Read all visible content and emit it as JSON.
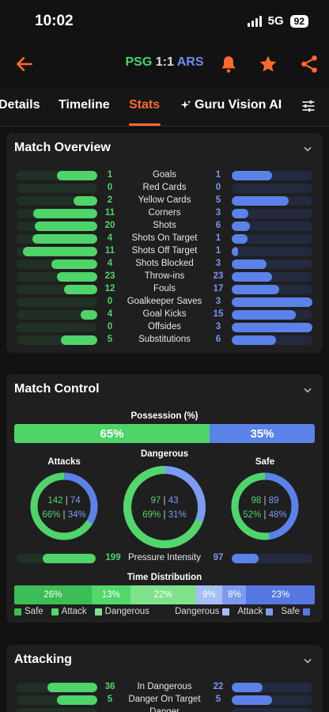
{
  "status_bar": {
    "time": "10:02",
    "network": "5G",
    "battery": "92"
  },
  "header": {
    "home_team": "PSG",
    "score": "1:1",
    "away_team": "ARS"
  },
  "tabs": [
    {
      "label": "Details"
    },
    {
      "label": "Timeline"
    },
    {
      "label": "Stats"
    },
    {
      "label": "Guru Vision AI"
    }
  ],
  "active_tab": "Stats",
  "colors": {
    "accent": "#ff6a2a",
    "home": "#4fd46a",
    "away": "#5b82e8"
  },
  "match_overview": {
    "title": "Match Overview",
    "rows": [
      {
        "label": "Goals",
        "home": "1",
        "away": "1",
        "home_pct": 0.5,
        "away_pct": 0.5
      },
      {
        "label": "Red Cards",
        "home": "0",
        "away": "0",
        "home_pct": 0,
        "away_pct": 0
      },
      {
        "label": "Yellow Cards",
        "home": "2",
        "away": "5",
        "home_pct": 0.29,
        "away_pct": 0.71
      },
      {
        "label": "Corners",
        "home": "11",
        "away": "3",
        "home_pct": 0.79,
        "away_pct": 0.21
      },
      {
        "label": "Shots",
        "home": "20",
        "away": "6",
        "home_pct": 0.77,
        "away_pct": 0.23
      },
      {
        "label": "Shots On Target",
        "home": "4",
        "away": "1",
        "home_pct": 0.8,
        "away_pct": 0.2
      },
      {
        "label": "Shots Off Target",
        "home": "11",
        "away": "1",
        "home_pct": 0.92,
        "away_pct": 0.08
      },
      {
        "label": "Shots Blocked",
        "home": "4",
        "away": "3",
        "home_pct": 0.57,
        "away_pct": 0.43
      },
      {
        "label": "Throw-ins",
        "home": "23",
        "away": "23",
        "home_pct": 0.5,
        "away_pct": 0.5
      },
      {
        "label": "Fouls",
        "home": "12",
        "away": "17",
        "home_pct": 0.41,
        "away_pct": 0.59
      },
      {
        "label": "Goalkeeper Saves",
        "home": "0",
        "away": "3",
        "home_pct": 0,
        "away_pct": 1
      },
      {
        "label": "Goal Kicks",
        "home": "4",
        "away": "15",
        "home_pct": 0.21,
        "away_pct": 0.79
      },
      {
        "label": "Offsides",
        "home": "0",
        "away": "3",
        "home_pct": 0,
        "away_pct": 1
      },
      {
        "label": "Substitutions",
        "home": "5",
        "away": "6",
        "home_pct": 0.45,
        "away_pct": 0.55
      }
    ]
  },
  "match_control": {
    "title": "Match Control",
    "possession_label": "Possession (%)",
    "possession_home": "65%",
    "possession_away": "35%",
    "possession_home_pct": 0.65,
    "attacks": {
      "label": "Attacks",
      "home": "142",
      "away": "74",
      "home_pct": "66%",
      "away_pct": "34%",
      "home_frac": 0.66
    },
    "dangerous": {
      "label": "Dangerous",
      "home": "97",
      "away": "43",
      "home_pct": "69%",
      "away_pct": "31%",
      "home_frac": 0.69
    },
    "safe": {
      "label": "Safe",
      "home": "98",
      "away": "89",
      "home_pct": "52%",
      "away_pct": "48%",
      "home_frac": 0.52
    },
    "pressure": {
      "label": "Pressure Intensity",
      "home": "199",
      "away": "97",
      "home_pct": 0.67,
      "away_pct": 0.33
    },
    "time_distribution": {
      "label": "Time Distribution",
      "segments": [
        {
          "value": "26%",
          "frac": 0.26,
          "color": "#3dbd55"
        },
        {
          "value": "13%",
          "frac": 0.13,
          "color": "#52d76a"
        },
        {
          "value": "22%",
          "frac": 0.22,
          "color": "#7ee38c"
        },
        {
          "value": "9%",
          "frac": 0.09,
          "color": "#a6bff5"
        },
        {
          "value": "8%",
          "frac": 0.08,
          "color": "#7c9bf0"
        },
        {
          "value": "23%",
          "frac": 0.23,
          "color": "#5577e0"
        }
      ],
      "legend_home": [
        "Safe",
        "Attack",
        "Dangerous"
      ],
      "legend_away": [
        "Dangerous",
        "Attack",
        "Safe"
      ]
    }
  },
  "attacking": {
    "title": "Attacking",
    "rows": [
      {
        "label": "In Dangerous",
        "home": "36",
        "away": "22",
        "home_pct": 0.62,
        "away_pct": 0.38
      },
      {
        "label": "Danger On Target",
        "home": "5",
        "away": "5",
        "home_pct": 0.5,
        "away_pct": 0.5
      },
      {
        "label": "Danger",
        "home": "",
        "away": "",
        "home_pct": 0,
        "away_pct": 0
      }
    ]
  }
}
